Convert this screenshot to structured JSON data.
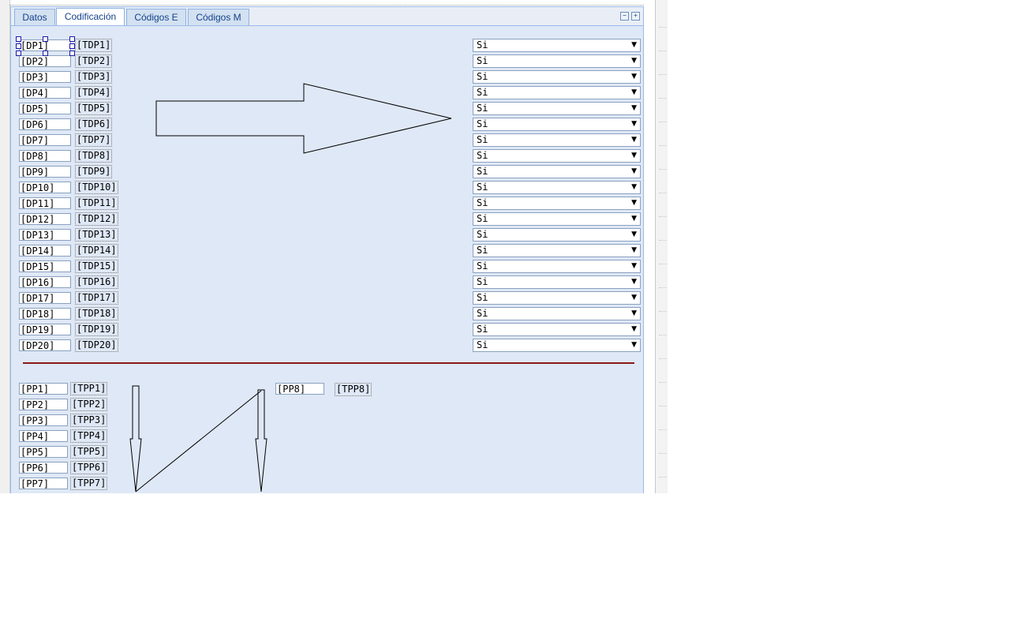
{
  "tabs": [
    {
      "label": "Datos"
    },
    {
      "label": "Codificación"
    },
    {
      "label": "Códigos E"
    },
    {
      "label": "Códigos M"
    }
  ],
  "tools": {
    "collapse_glyph": "−",
    "expand_glyph": "+"
  },
  "dp_rows": [
    {
      "dp": "[DP1]",
      "tdp": "[TDP1]",
      "sel": "Si"
    },
    {
      "dp": "[DP2]",
      "tdp": "[TDP2]",
      "sel": "Si"
    },
    {
      "dp": "[DP3]",
      "tdp": "[TDP3]",
      "sel": "Si"
    },
    {
      "dp": "[DP4]",
      "tdp": "[TDP4]",
      "sel": "Si"
    },
    {
      "dp": "[DP5]",
      "tdp": "[TDP5]",
      "sel": "Si"
    },
    {
      "dp": "[DP6]",
      "tdp": "[TDP6]",
      "sel": "Si"
    },
    {
      "dp": "[DP7]",
      "tdp": "[TDP7]",
      "sel": "Si"
    },
    {
      "dp": "[DP8]",
      "tdp": "[TDP8]",
      "sel": "Si"
    },
    {
      "dp": "[DP9]",
      "tdp": "[TDP9]",
      "sel": "Si"
    },
    {
      "dp": "[DP10]",
      "tdp": "[TDP10]",
      "sel": "Si"
    },
    {
      "dp": "[DP11]",
      "tdp": "[TDP11]",
      "sel": "Si"
    },
    {
      "dp": "[DP12]",
      "tdp": "[TDP12]",
      "sel": "Si"
    },
    {
      "dp": "[DP13]",
      "tdp": "[TDP13]",
      "sel": "Si"
    },
    {
      "dp": "[DP14]",
      "tdp": "[TDP14]",
      "sel": "Si"
    },
    {
      "dp": "[DP15]",
      "tdp": "[TDP15]",
      "sel": "Si"
    },
    {
      "dp": "[DP16]",
      "tdp": "[TDP16]",
      "sel": "Si"
    },
    {
      "dp": "[DP17]",
      "tdp": "[TDP17]",
      "sel": "Si"
    },
    {
      "dp": "[DP18]",
      "tdp": "[TDP18]",
      "sel": "Si"
    },
    {
      "dp": "[DP19]",
      "tdp": "[TDP19]",
      "sel": "Si"
    },
    {
      "dp": "[DP20]",
      "tdp": "[TDP20]",
      "sel": "Si"
    }
  ],
  "pp_rows": [
    {
      "pp": "[PP1]",
      "tpp": "[TPP1]"
    },
    {
      "pp": "[PP2]",
      "tpp": "[TPP2]"
    },
    {
      "pp": "[PP3]",
      "tpp": "[TPP3]"
    },
    {
      "pp": "[PP4]",
      "tpp": "[TPP4]"
    },
    {
      "pp": "[PP5]",
      "tpp": "[TPP5]"
    },
    {
      "pp": "[PP6]",
      "tpp": "[TPP6]"
    },
    {
      "pp": "[PP7]",
      "tpp": "[TPP7]"
    }
  ],
  "pp8": {
    "pp": "[PP8]",
    "tpp": "[TPP8]"
  },
  "colors": {
    "panel_bg": "#dfe8f6",
    "panel_border": "#99bbe8",
    "tab_text": "#15428b",
    "divider": "#8b1a1a",
    "selection_handle": "#1a1aaa"
  },
  "icons": {
    "collapse": "collapse-icon",
    "expand": "expand-icon",
    "dropdown": "dropdown-arrow-icon"
  }
}
